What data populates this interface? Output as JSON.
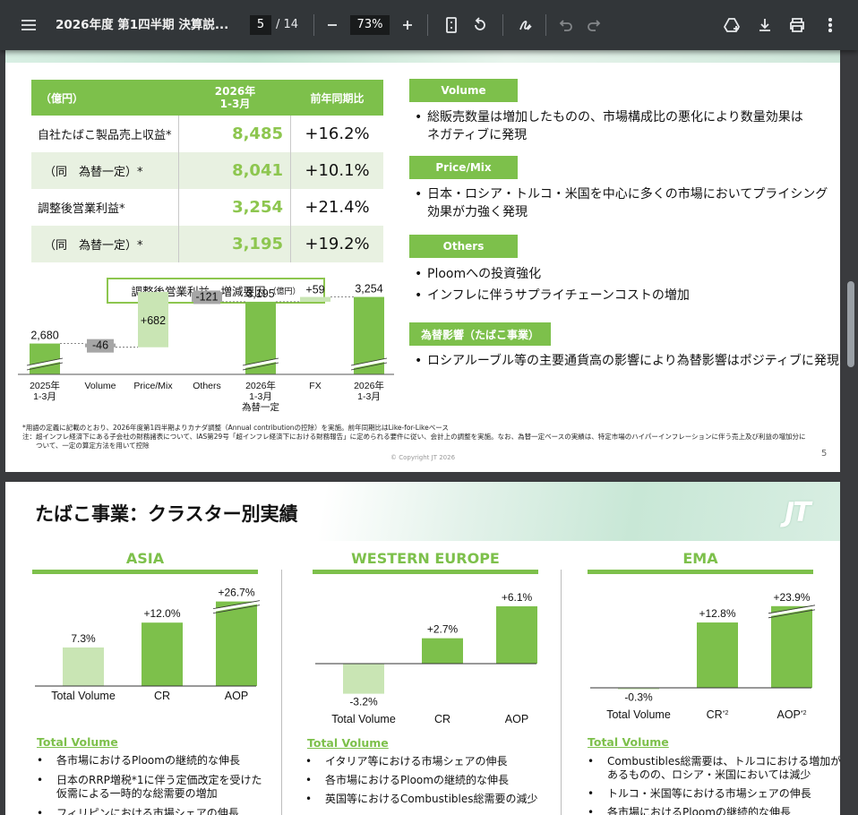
{
  "viewer": {
    "title": "2026年度 第1四半期 決算説...",
    "page_current": "5",
    "page_total": "/ 14",
    "zoom": "73%",
    "icons": [
      "menu-icon",
      "zoom-out-icon",
      "zoom-in-icon",
      "fit-page-icon",
      "rotate-icon",
      "annotate-icon",
      "undo-icon",
      "redo-icon",
      "drive-add-icon",
      "download-icon",
      "print-icon",
      "more-icon"
    ]
  },
  "page1": {
    "table": {
      "headers": [
        "（億円）",
        "2026年\n1-3月",
        "前年同期比"
      ],
      "rows": [
        {
          "label": "自社たばこ製品売上収益*",
          "value": "8,485",
          "change": "+16.2%"
        },
        {
          "label": "（同　為替一定）*",
          "value": "8,041",
          "change": "+10.1%"
        },
        {
          "label": "調整後営業利益*",
          "value": "3,254",
          "change": "+21.4%"
        },
        {
          "label": "（同　為替一定）*",
          "value": "3,195",
          "change": "+19.2%"
        }
      ]
    },
    "waterfall_title": "調整後営業利益　増減要因",
    "waterfall_unit": "（億円）",
    "chart_data": {
      "type": "bar",
      "title": "調整後営業利益　増減要因（億円）",
      "categories": [
        "2025年\n1-3月",
        "Volume",
        "Price/Mix",
        "Others",
        "2026年\n1-3月\n為替一定",
        "FX",
        "2026年\n1-3月"
      ],
      "values": [
        2680,
        -46,
        682,
        -121,
        3195,
        59,
        3254
      ],
      "value_labels": [
        "2,680",
        "-46",
        "+682",
        "-121",
        "3,195",
        "+59",
        "3,254"
      ],
      "kinds": [
        "total",
        "delta",
        "delta",
        "delta",
        "total",
        "delta",
        "total"
      ]
    },
    "factors": [
      {
        "badge": "Volume",
        "bullets": [
          "総販売数量は増加したものの、市場構成比の悪化により数量効果は",
          "ネガティブに発現"
        ]
      },
      {
        "badge": "Price/Mix",
        "bullets": [
          "日本・ロシア・トルコ・米国を中心に多くの市場においてプライシング",
          "効果が力強く発現"
        ]
      },
      {
        "badge": "Others",
        "bullets": [
          "Ploomへの投資強化",
          "インフレに伴うサプライチェーンコストの増加"
        ]
      },
      {
        "badge": "為替影響（たばこ事業）",
        "bullets": [
          "ロシアルーブル等の主要通貨高の影響により為替影響はポジティブに発現"
        ]
      }
    ],
    "footnotes": [
      "*用語の定義に記載のとおり、2026年度第1四半期よりカナダ調整（Annual contributionの控除）を実施。前年同期比はLike-for-Likeベース",
      "注：超インフレ経済下にある子会社の財務諸表について、IAS第29号「超インフレ経済下における財務報告」に定められる要件に従い、会計上の調整を実施。なお、為替一定ベースの実績は、特定市場のハイパーインフレーションに伴う売上及び利益の増加分に",
      "ついて、一定の算定方法を用いて控除"
    ],
    "copyright": "© Copyright JT 2026",
    "page_number": "5"
  },
  "page2": {
    "title": "たばこ事業：クラスター別実績",
    "logo": "JT",
    "clusters": [
      {
        "name": "ASIA",
        "chart_data": {
          "type": "bar",
          "categories": [
            "Total Volume",
            "CR",
            "AOP"
          ],
          "values": [
            7.3,
            12.0,
            26.7
          ],
          "value_labels": [
            "7.3%",
            "+12.0%",
            "+26.7%"
          ]
        },
        "sub_title": "Total Volume",
        "bullets": [
          "各市場におけるPloomの継続的な伸長",
          "日本のRRP増税*1に伴う定価改定を受けた",
          "仮需による一時的な総需要の増加",
          "フィリピンにおける市場シェアの伸長"
        ]
      },
      {
        "name": "WESTERN EUROPE",
        "chart_data": {
          "type": "bar",
          "categories": [
            "Total Volume",
            "CR",
            "AOP"
          ],
          "values": [
            -3.2,
            2.7,
            6.1
          ],
          "value_labels": [
            "-3.2%",
            "+2.7%",
            "+6.1%"
          ]
        },
        "sub_title": "Total Volume",
        "bullets": [
          "イタリア等における市場シェアの伸長",
          "各市場におけるPloomの継続的な伸長",
          "英国等におけるCombustibles総需要の減少"
        ]
      },
      {
        "name": "EMA",
        "chart_data": {
          "type": "bar",
          "categories": [
            "Total Volume",
            "CR*2",
            "AOP*2"
          ],
          "values": [
            -0.3,
            12.8,
            23.9
          ],
          "value_labels": [
            "-0.3%",
            "+12.8%",
            "+23.9%"
          ]
        },
        "sub_title": "Total Volume",
        "bullets": [
          "Combustibles総需要は、トルコにおける増加が",
          "あるものの、ロシア・米国においては減少",
          "トルコ・米国等における市場シェアの伸長",
          "各市場におけるPloomの継続的な伸長"
        ]
      }
    ]
  },
  "colors": {
    "accent": "#7dc04b",
    "light": "#c9e5b4",
    "gray_bar": "#a6a6a6",
    "toolbar": "#323639"
  }
}
